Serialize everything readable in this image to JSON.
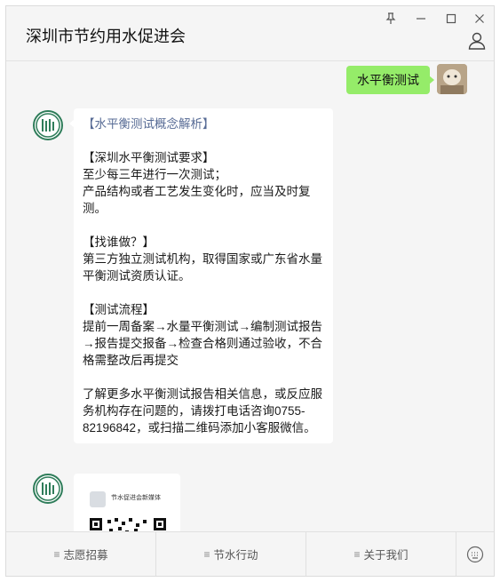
{
  "window": {
    "title": "深圳市节约用水促进会",
    "controls": [
      "pin-icon",
      "minimize-icon",
      "maximize-icon",
      "close-icon"
    ]
  },
  "messages": {
    "self": {
      "text": "水平衡测试"
    },
    "reply": {
      "heading": "【水平衡测试概念解析】",
      "section1_title": "【深圳水平衡测试要求】",
      "section1_line1": "至少每三年进行一次测试；",
      "section1_line2": "产品结构或者工艺发生变化时，应当及时复测。",
      "section2_title": "【找谁做？】",
      "section2_text": "第三方独立测试机构，取得国家或广东省水量平衡测试资质认证。",
      "section3_title": "【测试流程】",
      "section3_text": "提前一周备案→水量平衡测试→编制测试报告→报告提交报备→检查合格则通过验收，不合格需整改后再提交",
      "footer_text": "了解更多水平衡测试报告相关信息，或反应服务机构存在问题的，请拨打电话咨询0755-82196842，或扫描二维码添加小客服微信。"
    },
    "card": {
      "title": "节水促进会新媒体"
    }
  },
  "menu": {
    "items": [
      {
        "label": "志愿招募"
      },
      {
        "label": "节水行动"
      },
      {
        "label": "关于我们"
      }
    ],
    "keyboard_icon": "keyboard-icon"
  },
  "colors": {
    "self_bubble": "#95ec69",
    "link": "#576b95",
    "org_green": "#2f7d5a"
  }
}
